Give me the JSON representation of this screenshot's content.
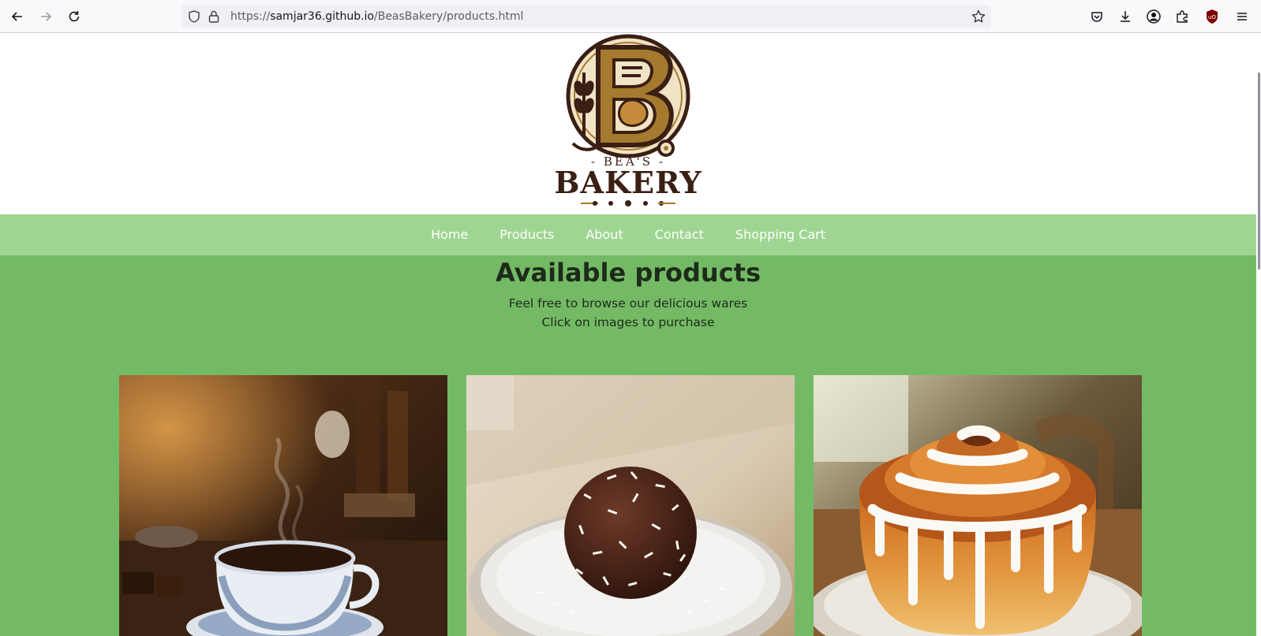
{
  "browser": {
    "url_prefix": "https://",
    "url_host": "samjar36.github.io",
    "url_path": "/BeasBakery/products.html",
    "icons": [
      "back-icon",
      "forward-icon",
      "reload-icon",
      "shield-icon",
      "lock-icon",
      "bookmark-star-icon",
      "pocket-icon",
      "download-icon",
      "account-icon",
      "extensions-icon",
      "ublock-icon",
      "menu-icon"
    ]
  },
  "logo": {
    "line1": "- BEA'S -",
    "line2": "BAKERY"
  },
  "nav": {
    "items": [
      "Home",
      "Products",
      "About",
      "Contact",
      "Shopping Cart"
    ]
  },
  "main": {
    "title": "Available products",
    "subtitle1": "Feel free to browse our delicious wares",
    "subtitle2": "Click on images to purchase",
    "products": [
      {
        "name": "coffee-cup"
      },
      {
        "name": "coconut-chocolate-ball"
      },
      {
        "name": "cinnamon-roll"
      }
    ]
  },
  "colors": {
    "nav_bg": "#9fd592",
    "main_bg": "#74ba65",
    "logo_brown": "#3a1f14",
    "logo_gold": "#a67a2e"
  }
}
